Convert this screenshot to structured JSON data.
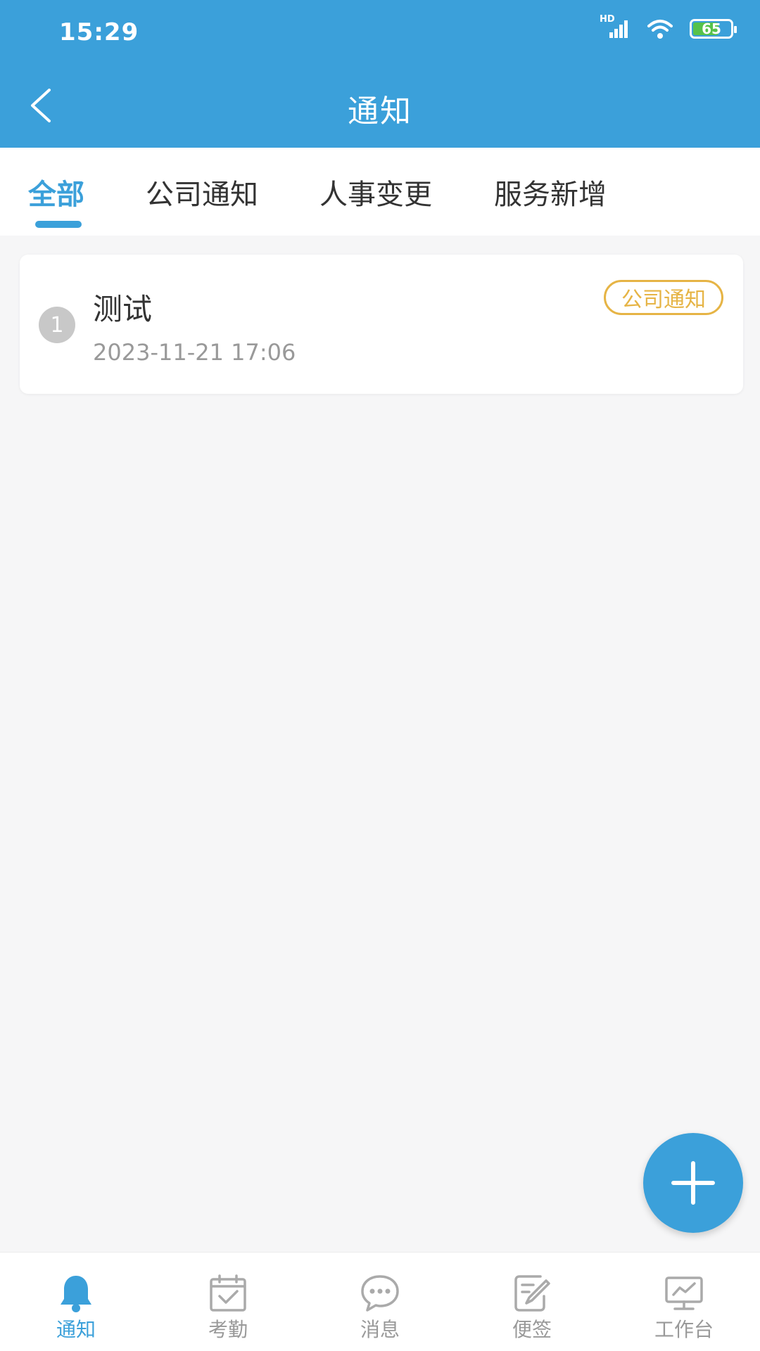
{
  "status_bar": {
    "time": "15:29",
    "network": "HD",
    "battery": "65"
  },
  "header": {
    "title": "通知"
  },
  "tabs": [
    {
      "label": "全部",
      "active": true
    },
    {
      "label": "公司通知",
      "active": false
    },
    {
      "label": "人事变更",
      "active": false
    },
    {
      "label": "服务新增",
      "active": false
    }
  ],
  "notices": [
    {
      "index": "1",
      "title": "测试",
      "time": "2023-11-21 17:06",
      "tag": "公司通知"
    }
  ],
  "bottom_nav": [
    {
      "label": "通知",
      "icon": "bell-icon",
      "active": true
    },
    {
      "label": "考勤",
      "icon": "calendar-check-icon",
      "active": false
    },
    {
      "label": "消息",
      "icon": "chat-bubble-icon",
      "active": false
    },
    {
      "label": "便签",
      "icon": "note-edit-icon",
      "active": false
    },
    {
      "label": "工作台",
      "icon": "monitor-chart-icon",
      "active": false
    }
  ],
  "colors": {
    "primary": "#3ba0da",
    "tag": "#e6b445",
    "inactive": "#999999"
  }
}
